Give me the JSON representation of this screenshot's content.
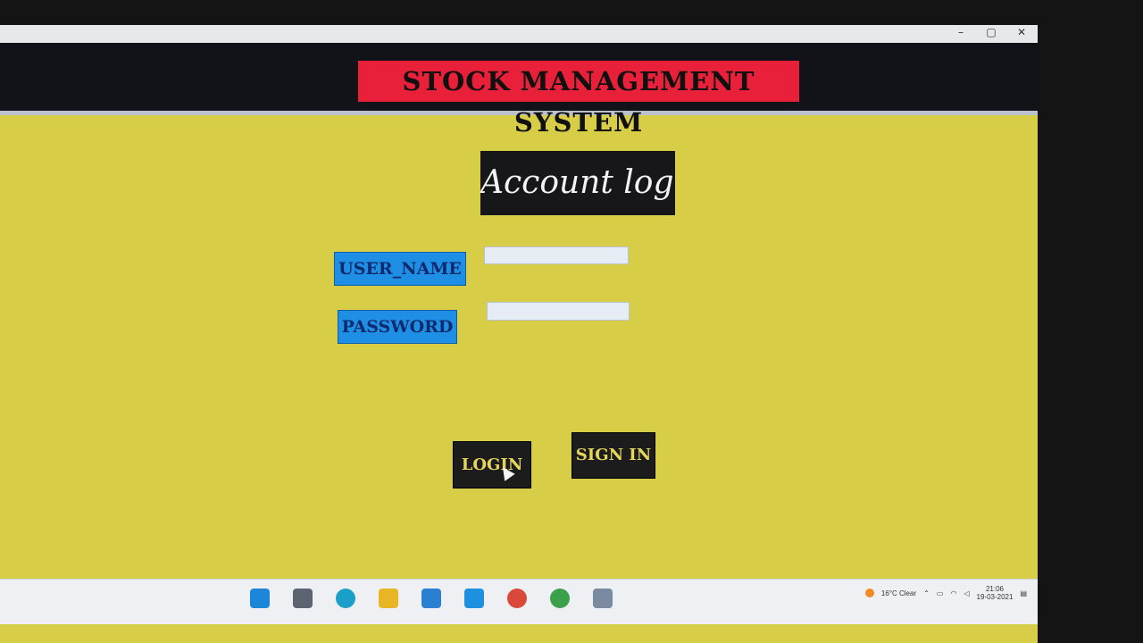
{
  "window": {
    "controls": {
      "minimize": "–",
      "maximize": "▢",
      "close": "✕"
    }
  },
  "app": {
    "title": "STOCK MANAGEMENT SYSTEM",
    "form_heading": "Account login"
  },
  "form": {
    "username_label": "USER_NAME",
    "password_label": "PASSWORD",
    "username_value": "",
    "password_value": ""
  },
  "buttons": {
    "login": "LOGIN",
    "sign_in": "SIGN IN"
  },
  "taskbar": {
    "icons": [
      "start-icon",
      "task-view-icon",
      "edge-icon",
      "file-explorer-icon",
      "store-icon",
      "mail-icon",
      "chrome-icon",
      "app-icon",
      "notes-icon"
    ],
    "weather": "16°C Clear",
    "time": "21:06",
    "date": "19-03-2021"
  },
  "colors": {
    "background": "#d8cd46",
    "header_band": "#121318",
    "title_bg": "#e8203a",
    "label_bg": "#1e8fe5",
    "button_bg": "#1c1c1c",
    "button_text": "#e6d55b"
  }
}
